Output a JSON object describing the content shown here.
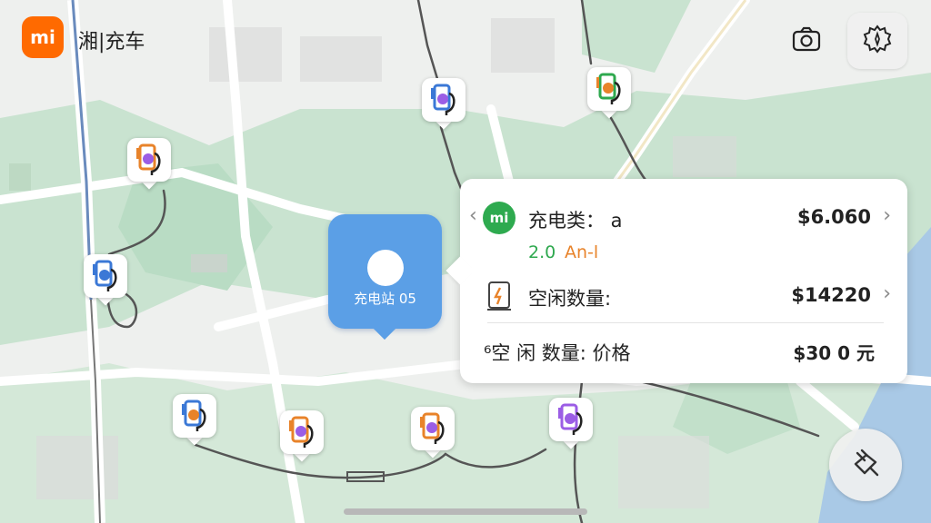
{
  "header": {
    "logo_text": "mi",
    "app_title": "湘|充车",
    "camera_icon": "camera-icon",
    "settings_icon": "gear-icon"
  },
  "map": {
    "selected_station_label": "充电站 05",
    "pin_icon": "ev-charger-icon"
  },
  "panel": {
    "badge_text": "mi",
    "charge_type_label": "充电类： a",
    "charge_type_price": "$6.060",
    "charge_speed_value": "2.0",
    "charge_speed_unit": "An-l",
    "free_count_label": "空闲数量:",
    "free_count_value": "$14220",
    "price_row_label": "⁶空 闲 数量: 价格",
    "price_row_value": "$30 0 元"
  },
  "colors": {
    "accent_orange": "#ff6a00",
    "selected_blue": "#5b9fe6",
    "green": "#2ea84e",
    "orange_text": "#e8832a"
  }
}
